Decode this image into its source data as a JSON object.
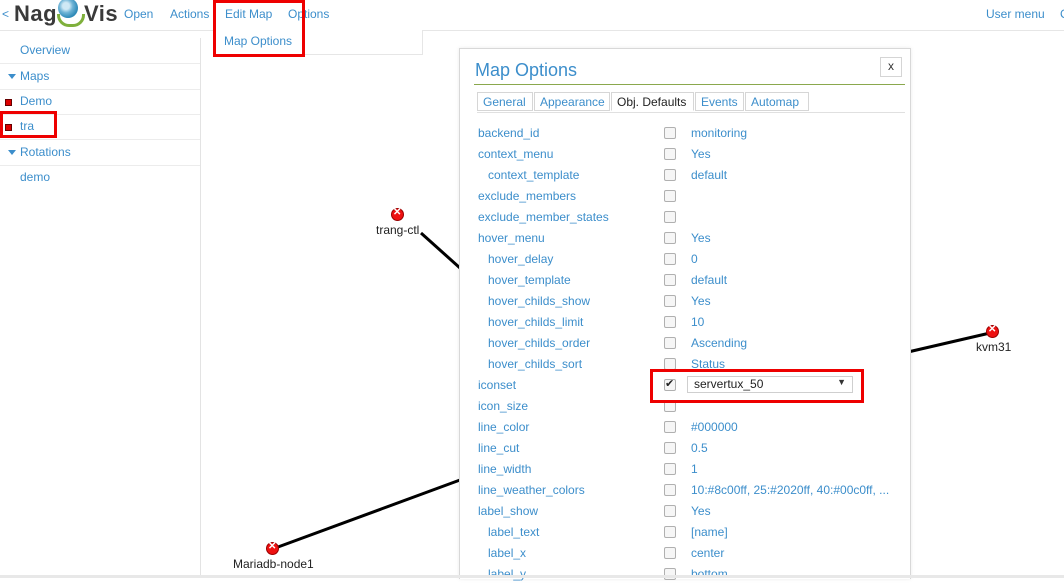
{
  "header": {
    "back_symbol": "<",
    "logo_part1": "Nag",
    "logo_part2": "Vis",
    "menu": [
      "Open",
      "Actions",
      "Edit Map",
      "Options"
    ],
    "user_menu": "User menu",
    "cut_item": "C",
    "edit_map_dropdown": [
      "Map Options"
    ]
  },
  "sidebar": {
    "overview": "Overview",
    "maps_header": "Maps",
    "maps": [
      "Demo",
      "tra"
    ],
    "rotations_header": "Rotations",
    "rotations": [
      "demo"
    ]
  },
  "map": {
    "nodes": [
      {
        "name": "trang-ctl",
        "state": "critical"
      },
      {
        "name": "kvm31",
        "state": "critical"
      },
      {
        "name": "Mariadb-node1",
        "state": "critical"
      }
    ]
  },
  "modal": {
    "title": "Map Options",
    "close_label": "x",
    "tabs": [
      "General",
      "Appearance",
      "Obj. Defaults",
      "Events",
      "Automap"
    ],
    "active_tab": "Obj. Defaults",
    "options": [
      {
        "name": "backend_id",
        "value": "monitoring",
        "checked": false,
        "indent": false
      },
      {
        "name": "context_menu",
        "value": "Yes",
        "checked": false,
        "indent": false
      },
      {
        "name": "context_template",
        "value": "default",
        "checked": false,
        "indent": true
      },
      {
        "name": "exclude_members",
        "value": "",
        "checked": false,
        "indent": false
      },
      {
        "name": "exclude_member_states",
        "value": "",
        "checked": false,
        "indent": false
      },
      {
        "name": "hover_menu",
        "value": "Yes",
        "checked": false,
        "indent": false
      },
      {
        "name": "hover_delay",
        "value": "0",
        "checked": false,
        "indent": true
      },
      {
        "name": "hover_template",
        "value": "default",
        "checked": false,
        "indent": true
      },
      {
        "name": "hover_childs_show",
        "value": "Yes",
        "checked": false,
        "indent": true
      },
      {
        "name": "hover_childs_limit",
        "value": "10",
        "checked": false,
        "indent": true
      },
      {
        "name": "hover_childs_order",
        "value": "Ascending",
        "checked": false,
        "indent": true
      },
      {
        "name": "hover_childs_sort",
        "value": "Status",
        "checked": false,
        "indent": true
      },
      {
        "name": "iconset",
        "value": "servertux_50",
        "checked": true,
        "indent": false,
        "select": true
      },
      {
        "name": "icon_size",
        "value": "",
        "checked": false,
        "indent": false
      },
      {
        "name": "line_color",
        "value": "#000000",
        "checked": false,
        "indent": false
      },
      {
        "name": "line_cut",
        "value": "0.5",
        "checked": false,
        "indent": false
      },
      {
        "name": "line_width",
        "value": "1",
        "checked": false,
        "indent": false
      },
      {
        "name": "line_weather_colors",
        "value": "10:#8c00ff, 25:#2020ff, 40:#00c0ff, ...",
        "checked": false,
        "indent": false
      },
      {
        "name": "label_show",
        "value": "Yes",
        "checked": false,
        "indent": false
      },
      {
        "name": "label_text",
        "value": "[name]",
        "checked": false,
        "indent": true
      },
      {
        "name": "label_x",
        "value": "center",
        "checked": false,
        "indent": true
      },
      {
        "name": "label_y",
        "value": "bottom",
        "checked": false,
        "indent": true
      }
    ]
  },
  "colors": {
    "link": "#3c8ecb",
    "highlight_box": "#ee0000",
    "critical": "#ee1111",
    "title_underline": "#8aa84d"
  }
}
